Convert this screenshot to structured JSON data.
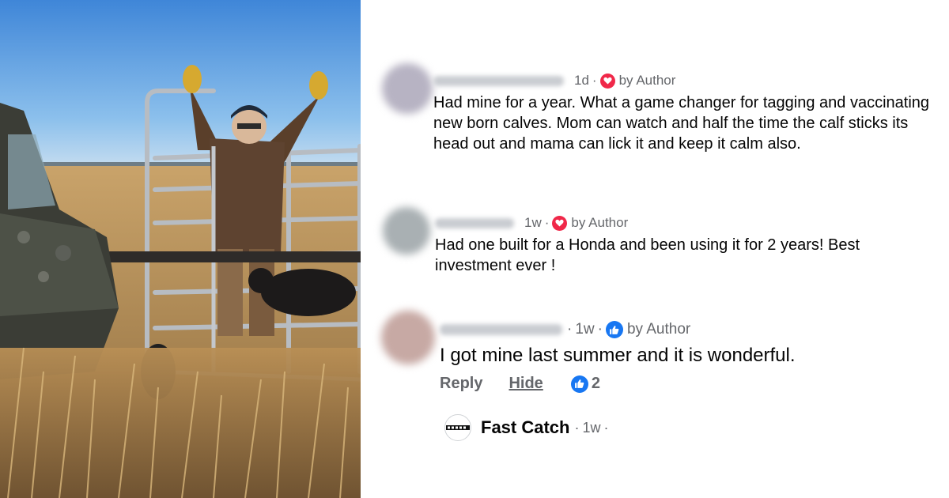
{
  "comments": [
    {
      "time": "1d",
      "separator": "·",
      "author_label": "by Author",
      "badge": "heart-icon",
      "text": "Had mine for a year. What a game changer for tagging and vaccinating new born calves. Mom can watch and half the time the calf sticks its head out and mama can lick it and keep it calm also."
    },
    {
      "time": "1w",
      "separator": "·",
      "author_label": "by Author",
      "badge": "heart-icon",
      "text": "Had one built for a Honda and been using it for 2 years! Best investment ever !"
    },
    {
      "time": "1w",
      "separator": "·",
      "author_label": "by Author",
      "badge": "like-icon",
      "text": "I got mine last summer and it is wonderful.",
      "reply_label": "Reply",
      "hide_label": "Hide",
      "reaction_count": "2"
    }
  ],
  "page_reply": {
    "name": "Fast Catch",
    "time": "1w",
    "separator": "·",
    "logo_text": "FAST CATCH"
  },
  "colors": {
    "heart": "#f02849",
    "like": "#1877f2",
    "meta_text": "#65676b"
  }
}
